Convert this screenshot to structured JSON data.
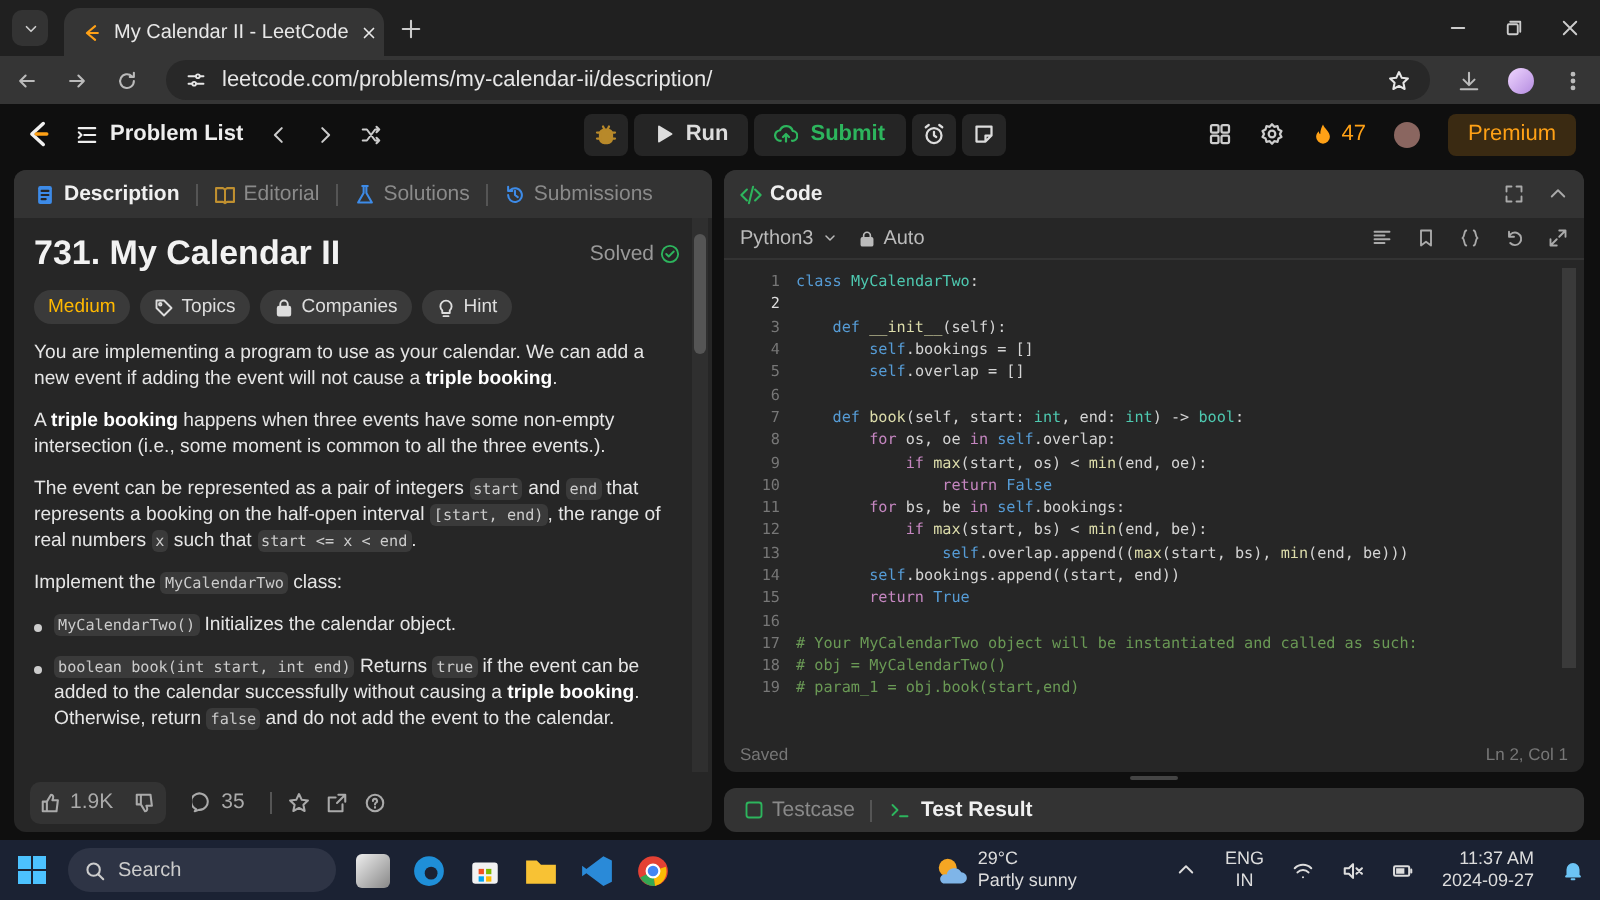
{
  "browser": {
    "tab_title": "My Calendar II - LeetCode",
    "url": "leetcode.com/problems/my-calendar-ii/description/"
  },
  "header": {
    "problem_list": "Problem List",
    "run": "Run",
    "submit": "Submit",
    "streak": "47",
    "premium": "Premium"
  },
  "description_panel": {
    "tabs": [
      {
        "label": "Description",
        "selected": true
      },
      {
        "label": "Editorial",
        "selected": false
      },
      {
        "label": "Solutions",
        "selected": false
      },
      {
        "label": "Submissions",
        "selected": false
      }
    ],
    "title": "731. My Calendar II",
    "status": "Solved",
    "tags": [
      {
        "label": "Medium",
        "kind": "difficulty"
      },
      {
        "label": "Topics",
        "kind": "topics"
      },
      {
        "label": "Companies",
        "kind": "companies"
      },
      {
        "label": "Hint",
        "kind": "hint"
      }
    ],
    "paragraphs": [
      {
        "kind": "text",
        "segments": [
          {
            "kind": "text",
            "text": "You are implementing a program to use as your calendar. We can add a new event if adding the event will not cause a **triple booking**."
          }
        ]
      },
      {
        "kind": "text",
        "segments": [
          {
            "kind": "text",
            "text": "A **triple booking** happens when three events have some non-empty intersection (i.e., some moment is common to all the three events.)."
          }
        ]
      },
      {
        "kind": "text",
        "segments": [
          {
            "kind": "text",
            "text": "The event can be represented as a pair of integers "
          },
          {
            "kind": "code",
            "text": "start"
          },
          {
            "kind": "text",
            "text": " and "
          },
          {
            "kind": "code",
            "text": "end"
          },
          {
            "kind": "text",
            "text": " that represents a booking on the half-open interval "
          },
          {
            "kind": "code",
            "text": "[start, end)"
          },
          {
            "kind": "text",
            "text": ", the range of real numbers "
          },
          {
            "kind": "code",
            "text": "x"
          },
          {
            "kind": "text",
            "text": " such that "
          },
          {
            "kind": "code",
            "text": "start <= x < end"
          },
          {
            "kind": "text",
            "text": "."
          }
        ]
      },
      {
        "kind": "text",
        "segments": [
          {
            "kind": "text",
            "text": "Implement the "
          },
          {
            "kind": "code",
            "text": "MyCalendarTwo"
          },
          {
            "kind": "text",
            "text": " class:"
          }
        ]
      },
      {
        "kind": "bullet",
        "segments": [
          {
            "kind": "code",
            "text": "MyCalendarTwo()"
          },
          {
            "kind": "text",
            "text": " Initializes the calendar object."
          }
        ]
      },
      {
        "kind": "bullet",
        "segments": [
          {
            "kind": "code",
            "text": "boolean book(int start, int end)"
          },
          {
            "kind": "text",
            "text": " Returns "
          },
          {
            "kind": "code",
            "text": "true"
          },
          {
            "kind": "text",
            "text": " if the event can be added to the calendar successfully without causing a **triple booking**. Otherwise, return "
          },
          {
            "kind": "code",
            "text": "false"
          },
          {
            "kind": "text",
            "text": " and do not add the event to the calendar."
          }
        ]
      }
    ],
    "footer": {
      "likes": "1.9K",
      "comments": "35"
    }
  },
  "code_panel": {
    "title": "Code",
    "language": "Python3",
    "mode": "Auto",
    "lines": [
      {
        "number": "1",
        "current": false,
        "tokens": [
          {
            "kind": "keyword",
            "text": "class "
          },
          {
            "kind": "type",
            "text": "MyCalendarTwo"
          },
          {
            "kind": "plain",
            "text": ":"
          }
        ]
      },
      {
        "number": "2",
        "current": true
      },
      {
        "number": "3",
        "current": false,
        "tokens": [
          {
            "kind": "keyword",
            "text": "    def "
          },
          {
            "kind": "function",
            "text": "__init__"
          },
          {
            "kind": "plain",
            "text": "(self):"
          }
        ]
      },
      {
        "number": "4",
        "current": false,
        "tokens": [
          {
            "kind": "keyword",
            "text": "        self"
          },
          {
            "kind": "plain",
            "text": ".bookings = []"
          }
        ]
      },
      {
        "number": "5",
        "current": false,
        "tokens": [
          {
            "kind": "keyword",
            "text": "        self"
          },
          {
            "kind": "plain",
            "text": ".overlap = []"
          }
        ]
      },
      {
        "number": "6",
        "current": false
      },
      {
        "number": "7",
        "current": false,
        "tokens": [
          {
            "kind": "keyword",
            "text": "    def "
          },
          {
            "kind": "function",
            "text": "book"
          },
          {
            "kind": "plain",
            "text": "(self, start: "
          },
          {
            "kind": "type",
            "text": "int"
          },
          {
            "kind": "plain",
            "text": ", end: "
          },
          {
            "kind": "type",
            "text": "int"
          },
          {
            "kind": "plain",
            "text": ") -> "
          },
          {
            "kind": "type",
            "text": "bool"
          },
          {
            "kind": "plain",
            "text": ":"
          }
        ]
      },
      {
        "number": "8",
        "current": false,
        "tokens": [
          {
            "kind": "control",
            "text": "        for"
          },
          {
            "kind": "plain",
            "text": " os, oe "
          },
          {
            "kind": "control",
            "text": "in "
          },
          {
            "kind": "keyword",
            "text": "self"
          },
          {
            "kind": "plain",
            "text": ".overlap:"
          }
        ]
      },
      {
        "number": "9",
        "current": false,
        "tokens": [
          {
            "kind": "control",
            "text": "            if "
          },
          {
            "kind": "function",
            "text": "max"
          },
          {
            "kind": "plain",
            "text": "(start, os) < "
          },
          {
            "kind": "function",
            "text": "min"
          },
          {
            "kind": "plain",
            "text": "(end, oe):"
          }
        ]
      },
      {
        "number": "10",
        "current": false,
        "tokens": [
          {
            "kind": "control",
            "text": "                return "
          },
          {
            "kind": "keyword",
            "text": "False"
          }
        ]
      },
      {
        "number": "11",
        "current": false,
        "tokens": [
          {
            "kind": "control",
            "text": "        for"
          },
          {
            "kind": "plain",
            "text": " bs, be "
          },
          {
            "kind": "control",
            "text": "in "
          },
          {
            "kind": "keyword",
            "text": "self"
          },
          {
            "kind": "plain",
            "text": ".bookings:"
          }
        ]
      },
      {
        "number": "12",
        "current": false,
        "tokens": [
          {
            "kind": "control",
            "text": "            if "
          },
          {
            "kind": "function",
            "text": "max"
          },
          {
            "kind": "plain",
            "text": "(start, bs) < "
          },
          {
            "kind": "function",
            "text": "min"
          },
          {
            "kind": "plain",
            "text": "(end, be):"
          }
        ]
      },
      {
        "number": "13",
        "current": false,
        "tokens": [
          {
            "kind": "keyword",
            "text": "                self"
          },
          {
            "kind": "plain",
            "text": ".overlap.append(("
          },
          {
            "kind": "function",
            "text": "max"
          },
          {
            "kind": "plain",
            "text": "(start, bs), "
          },
          {
            "kind": "function",
            "text": "min"
          },
          {
            "kind": "plain",
            "text": "(end, be)))"
          }
        ]
      },
      {
        "number": "14",
        "current": false,
        "tokens": [
          {
            "kind": "keyword",
            "text": "        self"
          },
          {
            "kind": "plain",
            "text": ".bookings.append((start, end))"
          }
        ]
      },
      {
        "number": "15",
        "current": false,
        "tokens": [
          {
            "kind": "control",
            "text": "        return "
          },
          {
            "kind": "keyword",
            "text": "True"
          }
        ]
      },
      {
        "number": "16",
        "current": false
      },
      {
        "number": "17",
        "current": false,
        "tokens": [
          {
            "kind": "comment",
            "text": "# Your MyCalendarTwo object will be instantiated and called as such:"
          }
        ]
      },
      {
        "number": "18",
        "current": false,
        "tokens": [
          {
            "kind": "comment",
            "text": "# obj = MyCalendarTwo()"
          }
        ]
      },
      {
        "number": "19",
        "current": false,
        "tokens": [
          {
            "kind": "comment",
            "text": "# param_1 = obj.book(start,end)"
          }
        ]
      }
    ],
    "status": "Saved",
    "cursor": "Ln 2, Col 1"
  },
  "result_panel": {
    "tabs": [
      {
        "label": "Testcase",
        "selected": false
      },
      {
        "label": "Test Result",
        "selected": true
      }
    ]
  },
  "taskbar": {
    "search_placeholder": "Search",
    "weather": {
      "temperature": "29°C",
      "condition": "Partly sunny"
    },
    "input_language": {
      "language": "ENG",
      "region": "IN"
    },
    "time": "11:37 AM",
    "date": "2024-09-27"
  }
}
